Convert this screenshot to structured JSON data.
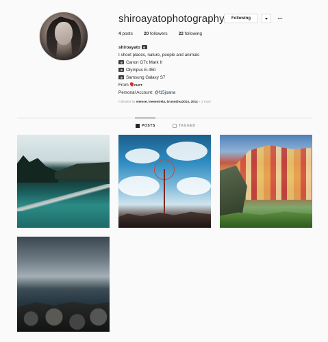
{
  "profile": {
    "username": "shiroayatophotography",
    "following_button": "Following",
    "more_icon": "ellipsis-icon"
  },
  "stats": {
    "posts_count": "4",
    "posts_label": "posts",
    "followers_count": "20",
    "followers_label": "followers",
    "following_count": "22",
    "following_label": "following"
  },
  "bio": {
    "name": "shiroayato",
    "line1": "I shoot places, nature, people and animals",
    "cam1": "Canon G7x Mark II",
    "cam2": "Olympus E-450",
    "cam3": "Samsung Galaxy S7",
    "from_label": "From",
    "from_place": "CHPT",
    "personal_label": "Personal Account:",
    "personal_handle": "@f15joana"
  },
  "followed_by": {
    "prefix": "Followed by",
    "names": "vnesse, inesestrela, brunodiva2014, 2014",
    "suffix": "+ 3 more"
  },
  "tabs": {
    "posts": "POSTS",
    "tagged": "TAGGED"
  },
  "posts": [
    {
      "subject": "river-canal-landscape"
    },
    {
      "subject": "ferris-wheel-sky"
    },
    {
      "subject": "colorful-cliff-village"
    },
    {
      "subject": "stormy-sea-rocks"
    }
  ],
  "colors": {
    "background": "#fafafa",
    "text": "#262626",
    "muted": "#999999",
    "link": "#003569",
    "border": "#dbdbdb"
  }
}
